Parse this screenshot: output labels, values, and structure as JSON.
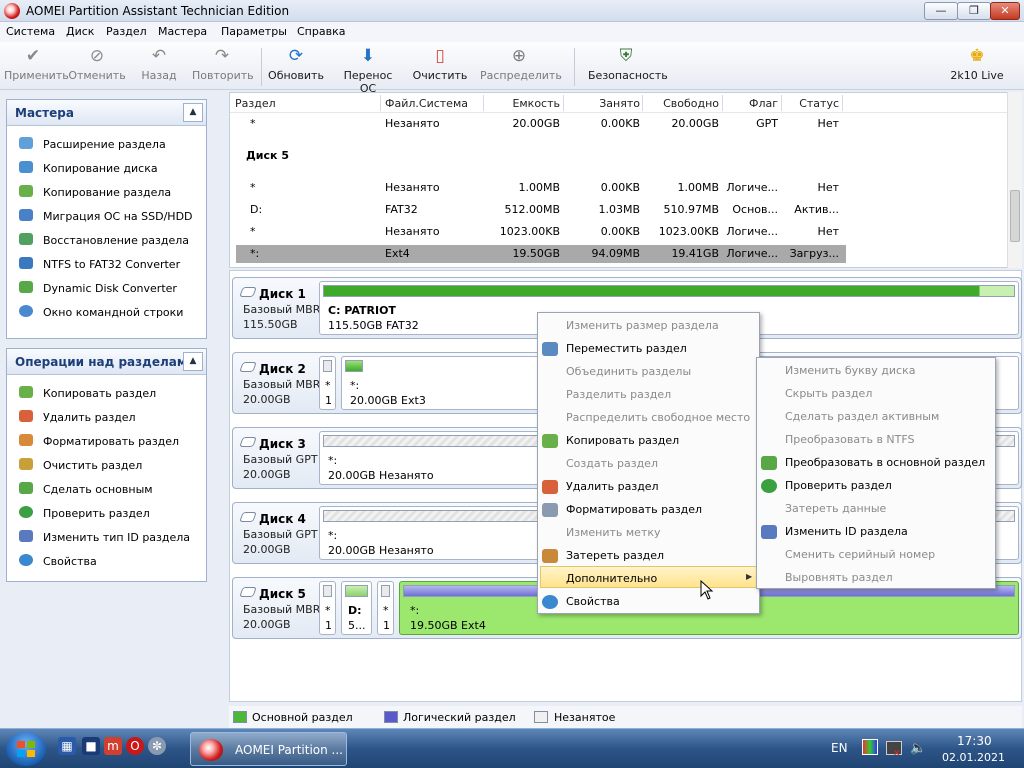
{
  "window": {
    "title": "AOMEI Partition Assistant Technician Edition"
  },
  "menu": [
    "Система",
    "Диск",
    "Раздел",
    "Мастера",
    "Параметры",
    "Справка"
  ],
  "toolbar": {
    "apply": "Применить",
    "cancel": "Отменить",
    "undo": "Назад",
    "redo": "Повторить",
    "refresh": "Обновить",
    "migrate_os": "Перенос ОС",
    "wipe": "Очистить",
    "allocate": "Распределить",
    "security": "Безопасность",
    "live": "2k10 Live"
  },
  "wizards": {
    "title": "Мастера",
    "items": [
      "Расширение раздела",
      "Копирование диска",
      "Копирование раздела",
      "Миграция ОС на SSD/HDD",
      "Восстановление раздела",
      "NTFS to FAT32 Converter",
      "Dynamic Disk Converter",
      "Окно командной строки"
    ]
  },
  "operations": {
    "title": "Операции над разделами",
    "items": [
      "Копировать раздел",
      "Удалить раздел",
      "Форматировать раздел",
      "Очистить раздел",
      "Сделать основным",
      "Проверить раздел",
      "Изменить тип ID раздела",
      "Свойства"
    ]
  },
  "table": {
    "headers": [
      "Раздел",
      "Файл.Система",
      "Емкость",
      "Занято",
      "Свободно",
      "Флаг",
      "Статус"
    ],
    "row0": [
      "*",
      "Незанято",
      "20.00GB",
      "0.00KB",
      "20.00GB",
      "GPT",
      "Нет"
    ],
    "disk5_label": "Диск 5",
    "rows": [
      [
        "*",
        "Незанято",
        "1.00MB",
        "0.00KB",
        "1.00MB",
        "Логиче...",
        "Нет"
      ],
      [
        "D:",
        "FAT32",
        "512.00MB",
        "1.03MB",
        "510.97MB",
        "Основ...",
        "Актив..."
      ],
      [
        "*",
        "Незанято",
        "1023.00KB",
        "0.00KB",
        "1023.00KB",
        "Логиче...",
        "Нет"
      ],
      [
        "*:",
        "Ext4",
        "19.50GB",
        "94.09MB",
        "19.41GB",
        "Логиче...",
        "Загруз..."
      ]
    ]
  },
  "disks": {
    "d1": {
      "name": "Диск 1",
      "type": "Базовый MBR",
      "size": "115.50GB",
      "part_name": "C: PATRIOT",
      "part_info": "115.50GB FAT32",
      "used": 0.95
    },
    "d2": {
      "name": "Диск 2",
      "type": "Базовый MBR",
      "size": "20.00GB",
      "small1": "*",
      "small1b": "1",
      "part_name": "*:",
      "part_info": "20.00GB Ext3"
    },
    "d3": {
      "name": "Диск 3",
      "type": "Базовый GPT",
      "size": "20.00GB",
      "part_name": "*:",
      "part_info": "20.00GB Незанято"
    },
    "d4": {
      "name": "Диск 4",
      "type": "Базовый GPT",
      "size": "20.00GB",
      "part_name": "*:",
      "part_info": "20.00GB Незанято"
    },
    "d5": {
      "name": "Диск 5",
      "type": "Базовый MBR",
      "size": "20.00GB",
      "p1a": "*",
      "p1b": "1",
      "p2a": "D:",
      "p2b": "5...",
      "p3a": "*",
      "p3b": "1",
      "part_name": "*:",
      "part_info": "19.50GB Ext4"
    }
  },
  "context_menu": {
    "items": [
      "Изменить размер раздела",
      "Переместить раздел",
      "Объединить разделы",
      "Разделить раздел",
      "Распределить свободное место",
      "Копировать раздел",
      "Создать раздел",
      "Удалить раздел",
      "Форматировать раздел",
      "Изменить метку",
      "Затереть раздел",
      "Дополнительно",
      "Свойства"
    ]
  },
  "submenu": {
    "items": [
      "Изменить букву диска",
      "Скрыть раздел",
      "Сделать раздел активным",
      "Преобразовать в NTFS",
      "Преобразовать в основной раздел",
      "Проверить раздел",
      "Затереть данные",
      "Изменить ID раздела",
      "Сменить серийный номер",
      "Выровнять раздел"
    ]
  },
  "legend": {
    "primary": "Основной раздел",
    "logical": "Логический раздел",
    "unallocated": "Незанятое"
  },
  "taskbar": {
    "app": "AOMEI Partition ...",
    "lang": "EN",
    "time": "17:30",
    "date": "02.01.2021"
  }
}
